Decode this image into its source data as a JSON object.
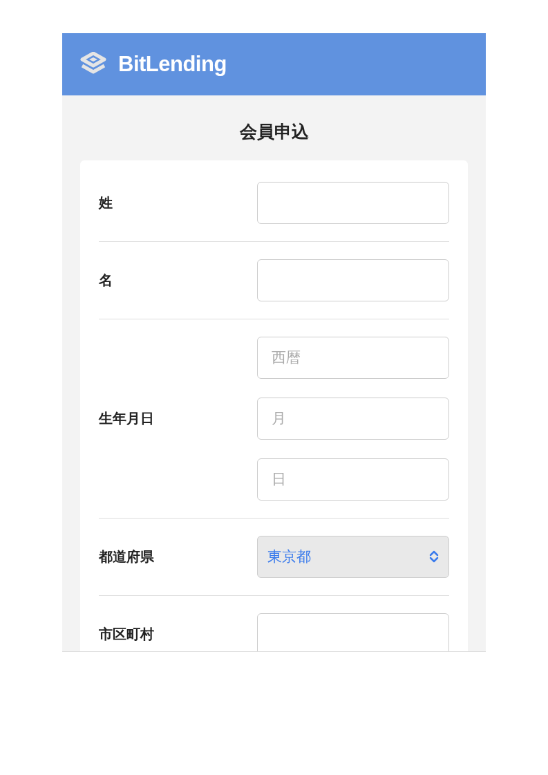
{
  "header": {
    "brand": "BitLending"
  },
  "page_title": "会員申込",
  "form": {
    "rows": [
      {
        "label": "姓",
        "fields": [
          {
            "kind": "input"
          }
        ]
      },
      {
        "label": "名",
        "fields": [
          {
            "kind": "input"
          }
        ]
      },
      {
        "label": "生年月日",
        "fields": [
          {
            "kind": "input",
            "placeholder": "西暦"
          },
          {
            "kind": "input",
            "placeholder": "月"
          },
          {
            "kind": "input",
            "placeholder": "日"
          }
        ]
      },
      {
        "label": "都道府県",
        "fields": [
          {
            "kind": "select",
            "value": "東京都"
          }
        ]
      },
      {
        "label": "市区町村",
        "fields": [
          {
            "kind": "input"
          }
        ]
      }
    ]
  }
}
